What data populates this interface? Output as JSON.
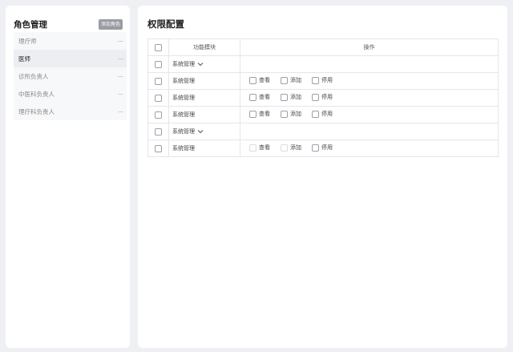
{
  "sidebar": {
    "title": "角色管理",
    "add_button": "添加角色",
    "items": [
      {
        "label": "理疗师",
        "dash": "—",
        "active": false
      },
      {
        "label": "医师",
        "dash": "—",
        "active": true
      },
      {
        "label": "诊所负责人",
        "dash": "—",
        "active": false
      },
      {
        "label": "中医科负责人",
        "dash": "—",
        "active": false
      },
      {
        "label": "理疗科负责人",
        "dash": "—",
        "active": false
      }
    ]
  },
  "main": {
    "title": "权限配置",
    "table": {
      "headers": {
        "module": "功能模块",
        "operations": "操作"
      },
      "rows": [
        {
          "type": "group",
          "module": "系统管理"
        },
        {
          "type": "item",
          "module": "系统管理",
          "ops": [
            {
              "label": "查看",
              "disabled": false
            },
            {
              "label": "添加",
              "disabled": false
            },
            {
              "label": "停用",
              "disabled": false
            }
          ]
        },
        {
          "type": "item",
          "module": "系统管理",
          "ops": [
            {
              "label": "查看",
              "disabled": false
            },
            {
              "label": "添加",
              "disabled": false
            },
            {
              "label": "停用",
              "disabled": false
            }
          ]
        },
        {
          "type": "item",
          "module": "系统管理",
          "ops": [
            {
              "label": "查看",
              "disabled": false
            },
            {
              "label": "添加",
              "disabled": false
            },
            {
              "label": "停用",
              "disabled": false
            }
          ]
        },
        {
          "type": "group",
          "module": "系统管理"
        },
        {
          "type": "item",
          "module": "系统管理",
          "ops": [
            {
              "label": "查看",
              "disabled": true
            },
            {
              "label": "添加",
              "disabled": true
            },
            {
              "label": "停用",
              "disabled": false
            }
          ]
        }
      ]
    }
  }
}
